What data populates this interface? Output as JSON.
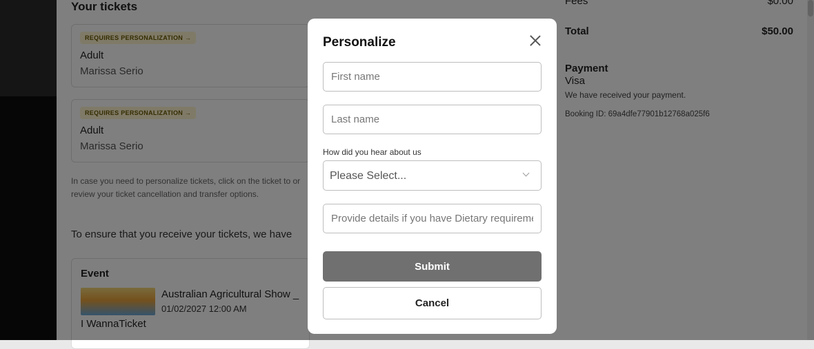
{
  "background": {
    "section_title": "Your tickets",
    "tickets": [
      {
        "badge": "REQUIRES PERSONALIZATION →",
        "type": "Adult",
        "name": "Marissa Serio"
      },
      {
        "badge": "REQUIRES PERSONALIZATION →",
        "type": "Adult",
        "name": "Marissa Serio"
      }
    ],
    "help_text": "In case you need to personalize tickets, click on the ticket to or review your ticket cancellation and transfer options.",
    "ensure_text": "To ensure that you receive your tickets, we have",
    "event": {
      "label": "Event",
      "title": "Australian Agricultural Show _",
      "date": "01/02/2027 12:00 AM",
      "organizer": "I WannaTicket"
    },
    "summary": {
      "fees_label": "Fees",
      "fees_value": "$0.00",
      "total_label": "Total",
      "total_value": "$50.00"
    },
    "payment": {
      "title": "Payment",
      "method": "Visa",
      "note": "We have received your payment.",
      "booking_id": "Booking ID: 69a4dfe77901b12768a025f6"
    }
  },
  "modal": {
    "title": "Personalize",
    "first_name_placeholder": "First name",
    "last_name_placeholder": "Last name",
    "hear_label": "How did you hear about us",
    "select_value": "Please Select...",
    "dietary_placeholder": "Provide details if you have Dietary requirements",
    "submit_label": "Submit",
    "cancel_label": "Cancel"
  },
  "colors": {
    "submit_bg": "#707070",
    "badge_bg": "#fff5cf",
    "overlay": "rgba(0,0,0,0.5)"
  }
}
